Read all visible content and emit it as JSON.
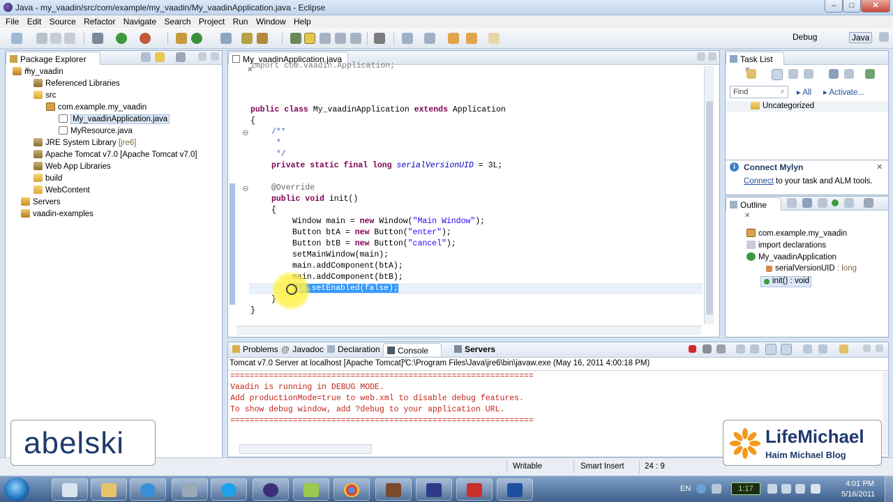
{
  "window": {
    "title": "Java - my_vaadin/src/com/example/my_vaadin/My_vaadinApplication.java - Eclipse",
    "controls": {
      "minimize": "–",
      "maximize": "□",
      "close": "✕"
    }
  },
  "menu": [
    "File",
    "Edit",
    "Source",
    "Refactor",
    "Navigate",
    "Search",
    "Project",
    "Run",
    "Window",
    "Help"
  ],
  "perspectives": {
    "debug": "Debug",
    "java": "Java"
  },
  "package_explorer": {
    "title": "Package Explorer",
    "close": "✕",
    "items": [
      {
        "label": "my_vaadin"
      },
      {
        "label": "Referenced Libraries"
      },
      {
        "label": "src"
      },
      {
        "label": "com.example.my_vaadin"
      },
      {
        "label": "My_vaadinApplication.java"
      },
      {
        "label": "MyResource.java"
      },
      {
        "label": "JRE System Library",
        "suffix": "[jre6]"
      },
      {
        "label": "Apache Tomcat v7.0 [Apache Tomcat v7.0]"
      },
      {
        "label": "Web App Libraries"
      },
      {
        "label": "build"
      },
      {
        "label": "WebContent"
      },
      {
        "label": "Servers"
      },
      {
        "label": "vaadin-examples"
      }
    ]
  },
  "editor": {
    "tab": "My_vaadinApplication.java",
    "close": "✕",
    "lines": {
      "import": "import com.vaadin.Application;",
      "class_kw1": "public",
      "class_kw2": "class",
      "class_name": " My_vaadinApplication ",
      "class_kw3": "extends",
      "class_super": " Application",
      "brace_open": "{",
      "doc1": "/**",
      "doc2": " *",
      "doc3": " */",
      "field_mods": "private static final long ",
      "field_name": "serialVersionUID",
      "field_val": " = 3L;",
      "annotation": "@Override",
      "init_kw": "public void",
      "init_rest": " init()",
      "brace2": "{",
      "l_window_a": "Window main = ",
      "l_window_kw": "new",
      "l_window_b": " Window(",
      "l_window_str": "\"Main Window\"",
      "l_window_c": ");",
      "l_bta_a": "Button btA = ",
      "l_bta_kw": "new",
      "l_bta_b": " Button(",
      "l_bta_str": "\"enter\"",
      "l_bta_c": ");",
      "l_btb_a": "Button btB = ",
      "l_btb_kw": "new",
      "l_btb_b": " Button(",
      "l_btb_str": "\"cancel\"",
      "l_btb_c": ");",
      "l_set": "setMainWindow(main);",
      "l_add1": "main.addComponent(btA);",
      "l_add2": "main.addComponent(btB);",
      "l_enabled": "btB.setEnabled(false);",
      "brace3": "}",
      "brace4": "}"
    }
  },
  "tasklist": {
    "title": "Task List",
    "close": "✕",
    "find_placeholder": "Find",
    "all": "All",
    "activate": "Activate...",
    "category": "Uncategorized"
  },
  "mylyn": {
    "title": "Connect Mylyn",
    "close": "✕",
    "link": "Connect",
    "rest": " to your task and ALM tools."
  },
  "outline": {
    "title": "Outline",
    "close": "✕",
    "items": [
      {
        "label": "com.example.my_vaadin"
      },
      {
        "label": "import declarations"
      },
      {
        "label": "My_vaadinApplication"
      },
      {
        "label": "serialVersionUID",
        "type": " : long"
      },
      {
        "label": "init() : void"
      }
    ]
  },
  "console": {
    "tabs": [
      "Problems",
      "Javadoc",
      "Declaration",
      "Console",
      "Servers"
    ],
    "close": "✕",
    "header": "Tomcat v7.0 Server at localhost [Apache Tomcat] C:\\Program Files\\Java\\jre6\\bin\\javaw.exe (May 16, 2011 4:00:18 PM)",
    "lines": [
      "===============================================================",
      "Vaadin is running in DEBUG MODE.",
      "Add productionMode=true to web.xml to disable debug features.",
      "To show debug window, add ?debug to your application URL.",
      "==============================================================="
    ]
  },
  "status": {
    "mode": "Writable",
    "insert": "Smart Insert",
    "position": "24 : 9"
  },
  "overlay": {
    "abelski": "abelski",
    "lifemichael_title": "LifeMichael",
    "lifemichael_sub": "Haim Michael Blog"
  },
  "taskbar": {
    "language": "EN",
    "battery": "1:17",
    "time": "4:01 PM",
    "date": "5/16/2011"
  },
  "colors": {
    "keyword": "#7f0055",
    "string": "#2a00ff",
    "console_text": "#c1271b",
    "selection": "#3399ff"
  }
}
